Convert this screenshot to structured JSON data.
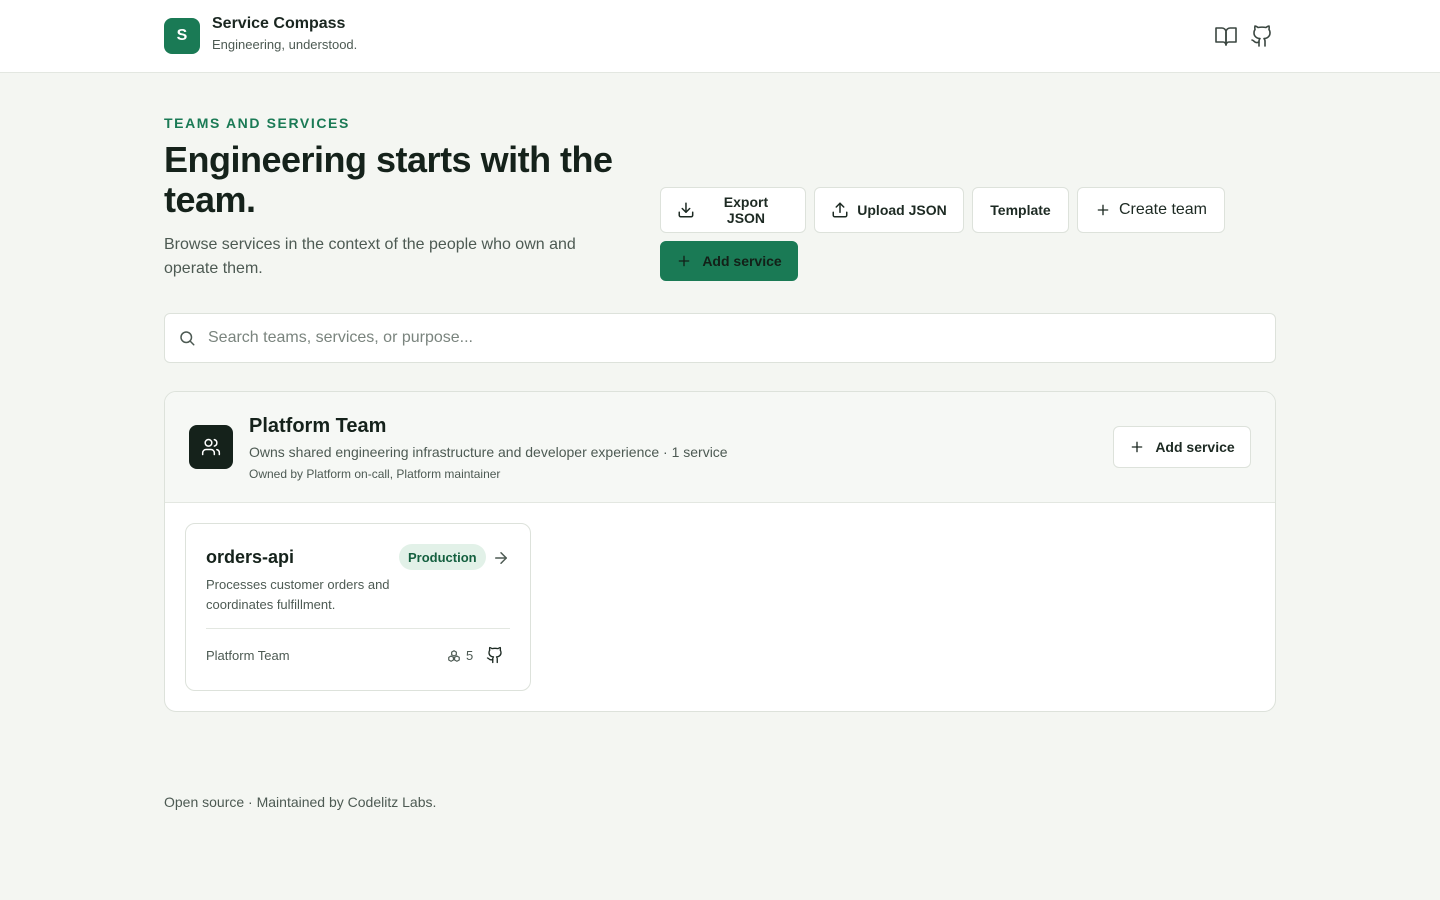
{
  "header": {
    "logo_letter": "S",
    "title": "Service Compass",
    "subtitle": "Engineering, understood.",
    "icons": [
      "book-icon",
      "github-icon"
    ]
  },
  "hero": {
    "eyebrow": "TEAMS AND SERVICES",
    "title": "Engineering starts with the team.",
    "description": "Browse services in the context of the people who own and operate them."
  },
  "actions": {
    "export_label": "Export JSON",
    "upload_label": "Upload JSON",
    "template_label": "Template",
    "create_team_label": "Create team",
    "add_service_label": "Add service"
  },
  "search": {
    "placeholder": "Search teams, services, or purpose...",
    "value": ""
  },
  "team": {
    "name": "Platform Team",
    "description": "Owns shared engineering infrastructure and developer experience · 1 service",
    "owned_by": "Owned by Platform on-call, Platform maintainer",
    "add_service_label": "Add service",
    "services": [
      {
        "name": "orders-api",
        "environment": "Production",
        "description": "Processes customer orders and coordinates fulfillment.",
        "team": "Platform Team",
        "dependencies": "5"
      }
    ]
  },
  "footer": {
    "text": "Open source · Maintained by Codelitz Labs."
  },
  "colors": {
    "accent": "#1a7a55",
    "background": "#f4f6f2",
    "badge_bg": "#e2f1e8"
  }
}
